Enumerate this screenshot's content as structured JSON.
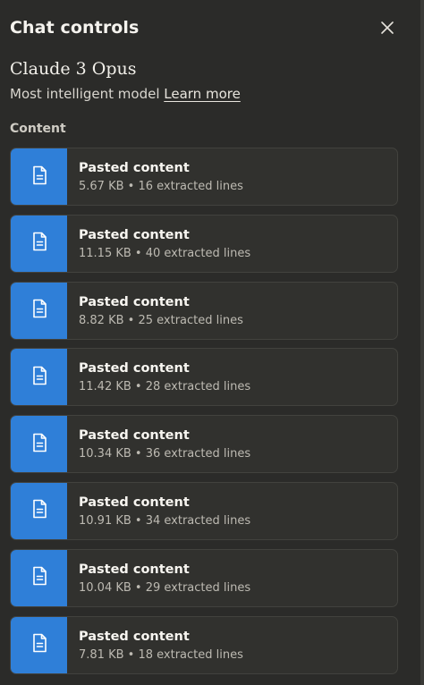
{
  "header": {
    "title": "Chat controls",
    "close_icon": "close-icon"
  },
  "model": {
    "name": "Claude 3 Opus",
    "description": "Most intelligent model",
    "learn_more": "Learn more"
  },
  "content": {
    "label": "Content",
    "items": [
      {
        "title": "Pasted content",
        "meta": "5.67 KB • 16 extracted lines",
        "icon": "document-icon"
      },
      {
        "title": "Pasted content",
        "meta": "11.15 KB • 40 extracted lines",
        "icon": "document-icon"
      },
      {
        "title": "Pasted content",
        "meta": "8.82 KB • 25 extracted lines",
        "icon": "document-icon"
      },
      {
        "title": "Pasted content",
        "meta": "11.42 KB • 28 extracted lines",
        "icon": "document-icon"
      },
      {
        "title": "Pasted content",
        "meta": "10.34 KB • 36 extracted lines",
        "icon": "document-icon"
      },
      {
        "title": "Pasted content",
        "meta": "10.91 KB • 34 extracted lines",
        "icon": "document-icon"
      },
      {
        "title": "Pasted content",
        "meta": "10.04 KB • 29 extracted lines",
        "icon": "document-icon"
      },
      {
        "title": "Pasted content",
        "meta": "7.81 KB • 18 extracted lines",
        "icon": "document-icon"
      }
    ]
  },
  "colors": {
    "background": "#2b2b29",
    "card": "#31312e",
    "icon_tile": "#2f7fd8"
  }
}
